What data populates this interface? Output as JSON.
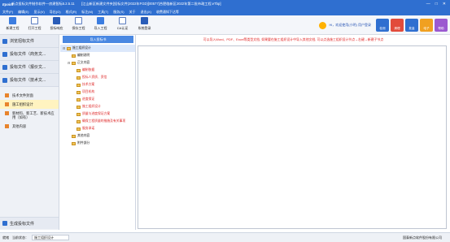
{
  "titlebar": {
    "logo": "Epoint",
    "title": "新点投标文件制作软件—房建智标5.2.5.11　　[江山新区新建文件夹]投标文件(2022年FGD)[00577]合肥临新区2022年第二批市政工程.eTbp]",
    "minimize": "—",
    "maximize": "□",
    "close": "✕"
  },
  "menubar": {
    "items": [
      "文件(F)",
      "编辑(E)",
      "显示(V)",
      "导出(O)",
      "格式(R)",
      "标注(M)",
      "工具(T)",
      "服务(S)",
      "关于",
      "退出(X)",
      "收费通知下达等"
    ]
  },
  "toolbar": {
    "items": [
      {
        "label": "新建工程",
        "icon": "new-project-icon",
        "color": "blue"
      },
      {
        "label": "打开工程",
        "icon": "open-project-icon",
        "color": "outline"
      },
      {
        "label": "投标响应",
        "icon": "bid-response-icon",
        "color": "dblue"
      },
      {
        "label": "保存工程",
        "icon": "save-project-icon",
        "color": "outline"
      },
      {
        "label": "导入工程",
        "icon": "import-project-icon",
        "color": "blue"
      },
      {
        "label": "CA认证",
        "icon": "ca-cert-icon",
        "color": "outline"
      },
      {
        "label": "系统登录",
        "icon": "system-login-icon",
        "color": "dblue"
      }
    ]
  },
  "user": {
    "text": "Hi，欢迎使用(小明) 用户登录"
  },
  "right_buttons": [
    {
      "label": "检测",
      "color": "#2f6fd0"
    },
    {
      "label": "清理",
      "color": "#e24b3b"
    },
    {
      "label": "批量",
      "color": "#2f6fd0"
    },
    {
      "label": "电子",
      "color": "#f0a020"
    },
    {
      "label": "帮助",
      "color": "#9b59d0"
    }
  ],
  "left_panel": {
    "sections": [
      {
        "label": "浏览招标文件"
      },
      {
        "label": "投标文件（商务文..."
      },
      {
        "label": "投标文件（报价文..."
      },
      {
        "label": "投标文件（技术文..."
      }
    ],
    "subitems": [
      {
        "label": "技术文件封面"
      },
      {
        "label": "施工组织设计"
      },
      {
        "label": "新材料、新工艺、新技术应用（如有）"
      },
      {
        "label": "其他内容"
      }
    ],
    "bottom": "生成投标文件"
  },
  "tree": {
    "import_button": "导入投标书",
    "nodes": [
      {
        "label": "施工组织设计",
        "level": 0,
        "expander": "⊟",
        "red": false
      },
      {
        "label": "编制说明",
        "level": 1,
        "expander": "",
        "red": false
      },
      {
        "label": "正文内容",
        "level": 1,
        "expander": "⊟",
        "red": false
      },
      {
        "label": "编制依据",
        "level": 2,
        "expander": "",
        "red": true
      },
      {
        "label": "投标人资质、资信",
        "level": 2,
        "expander": "",
        "red": true
      },
      {
        "label": "技术方案",
        "level": 2,
        "expander": "",
        "red": true
      },
      {
        "label": "项目机构",
        "level": 2,
        "expander": "",
        "red": true
      },
      {
        "label": "进度保证",
        "level": 2,
        "expander": "",
        "red": true
      },
      {
        "label": "施工组织设计",
        "level": 2,
        "expander": "",
        "red": true
      },
      {
        "label": "质量与进度保证方案",
        "level": 2,
        "expander": "",
        "red": true
      },
      {
        "label": "确保工程质量的措施及有关事项",
        "level": 2,
        "expander": "",
        "red": true
      },
      {
        "label": "服务承诺",
        "level": 2,
        "expander": "",
        "red": true
      },
      {
        "label": "其他内容",
        "level": 1,
        "expander": "",
        "red": false
      },
      {
        "label": "附件部分",
        "level": 1,
        "expander": "",
        "red": false
      }
    ]
  },
  "content": {
    "notice": "可以导入Word、PDF、Excel等类型文档, 如果要在施工组织设计中导入其他文档, 可以点选施工组织设计节点→右键→新建子节点"
  },
  "statusbar": {
    "label1": "就绪",
    "label2": "当前状态：",
    "value": "施工组织设计",
    "right": "国泰新点软件股份有限公司"
  }
}
